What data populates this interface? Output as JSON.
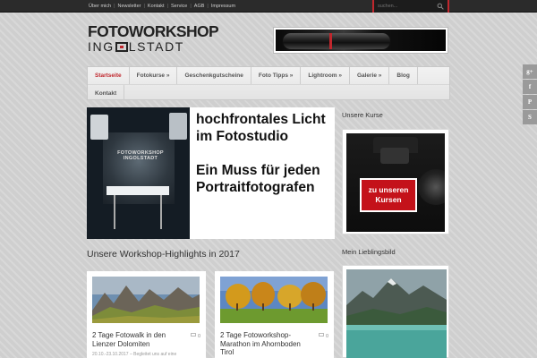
{
  "top_nav": {
    "items": [
      "Über mich",
      "Newsletter",
      "Kontakt",
      "Service",
      "AGB",
      "Impressum"
    ]
  },
  "search": {
    "placeholder": "suchen..."
  },
  "logo": {
    "line1": "FOTOWORKSHOP",
    "line2a": "ING",
    "line2b": "LSTADT"
  },
  "main_nav": {
    "row1": [
      {
        "label": "Startseite",
        "active": true
      },
      {
        "label": "Fotokurse »"
      },
      {
        "label": "Geschenkgutscheine"
      },
      {
        "label": "Foto Tipps »"
      },
      {
        "label": "Lightroom »"
      },
      {
        "label": "Galerie »"
      },
      {
        "label": "Blog"
      }
    ],
    "row2": [
      {
        "label": "Kontakt"
      }
    ]
  },
  "feature": {
    "photo_text": "FOTOWORKSHOP INGOLSTADT",
    "text_part1": "hochfrontales Licht im Fotostudio",
    "text_part2": "Ein Muss für jeden Portraitfotografen"
  },
  "section": {
    "title": "Unsere Workshop-Highlights in 2017"
  },
  "posts": [
    {
      "title": "2 Tage Fotowalk in den Lienzer Dolomiten",
      "comments": "0",
      "meta": "20.10.-23.10.2017 – Begleitet uns auf eine"
    },
    {
      "title": "2 Tage Fotoworkshop-Marathon im Ahornboden Tirol",
      "comments": "0",
      "meta": ""
    }
  ],
  "sidebar": {
    "kurse_title": "Unsere Kurse",
    "kurse_button_line1": "zu unseren",
    "kurse_button_line2": "Kursen",
    "lieblingsbild_title": "Mein Lieblingsbild"
  },
  "social": {
    "items": [
      {
        "icon": "google-plus-icon",
        "glyph": "g+"
      },
      {
        "icon": "facebook-icon",
        "glyph": "f"
      },
      {
        "icon": "pinterest-icon",
        "glyph": "P"
      },
      {
        "icon": "skype-icon",
        "glyph": "S"
      }
    ]
  },
  "colors": {
    "accent": "#c0272d",
    "topbar": "#2b2b2b",
    "background": "#cfcfcf"
  }
}
